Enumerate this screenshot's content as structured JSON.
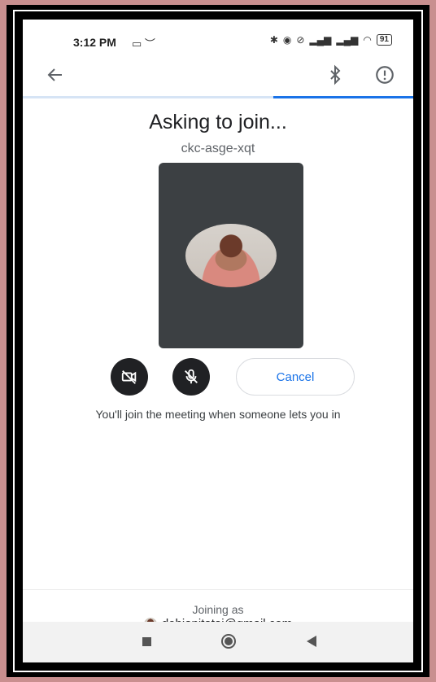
{
  "status_bar": {
    "time": "3:12 PM",
    "battery": "91"
  },
  "screen": {
    "title": "Asking to join...",
    "meeting_code": "ckc-asge-xqt",
    "cancel_label": "Cancel",
    "message": "You'll join the meeting when someone lets you in"
  },
  "footer": {
    "joining_label": "Joining as",
    "account_email": "debjanitatai@gmail.com"
  },
  "progress": {
    "fraction": 0.37
  },
  "colors": {
    "accent": "#1a73e8",
    "preview_bg": "#3c4043",
    "button_dark": "#202124",
    "border_frame": "#c98f8f"
  },
  "icons": {
    "back": "arrow-left-icon",
    "bluetooth": "bluetooth-icon",
    "info": "alert-circle-icon",
    "camera_off": "camera-off-icon",
    "mic_off": "mic-off-icon"
  }
}
